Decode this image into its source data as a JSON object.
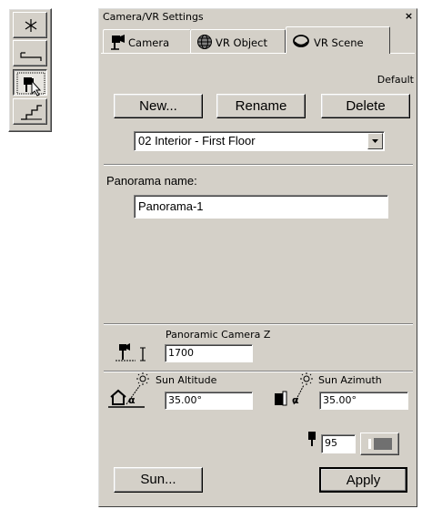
{
  "toolbox": {
    "buttons": [
      {
        "icon": "asterisk-icon"
      },
      {
        "icon": "section-line-icon"
      },
      {
        "icon": "camera-select-icon"
      },
      {
        "icon": "stairs-icon"
      }
    ]
  },
  "dialog": {
    "title": "Camera/VR Settings",
    "close": "×",
    "tabs": [
      {
        "label": "Camera",
        "icon": "camera-icon"
      },
      {
        "label": "VR Object",
        "icon": "globe-icon"
      },
      {
        "label": "VR Scene",
        "icon": "vr-scene-icon"
      }
    ],
    "default_label": "Default",
    "buttons": {
      "new": "New...",
      "rename": "Rename",
      "delete": "Delete",
      "sun": "Sun...",
      "apply": "Apply"
    },
    "story_select": {
      "value": "02  Interior - First Floor"
    },
    "panorama_name_label": "Panorama name:",
    "panorama_name_value": "Panorama-1",
    "camera_z": {
      "label": "Panoramic Camera Z",
      "value": "1700"
    },
    "sun_altitude": {
      "label": "Sun Altitude",
      "value": "35.00°"
    },
    "sun_azimuth": {
      "label": "Sun Azimuth",
      "value": "35.00°"
    },
    "light_value": "95",
    "colors": {
      "face": "#d4d0c8",
      "shadow": "#808080",
      "highlight": "#ffffff"
    }
  }
}
